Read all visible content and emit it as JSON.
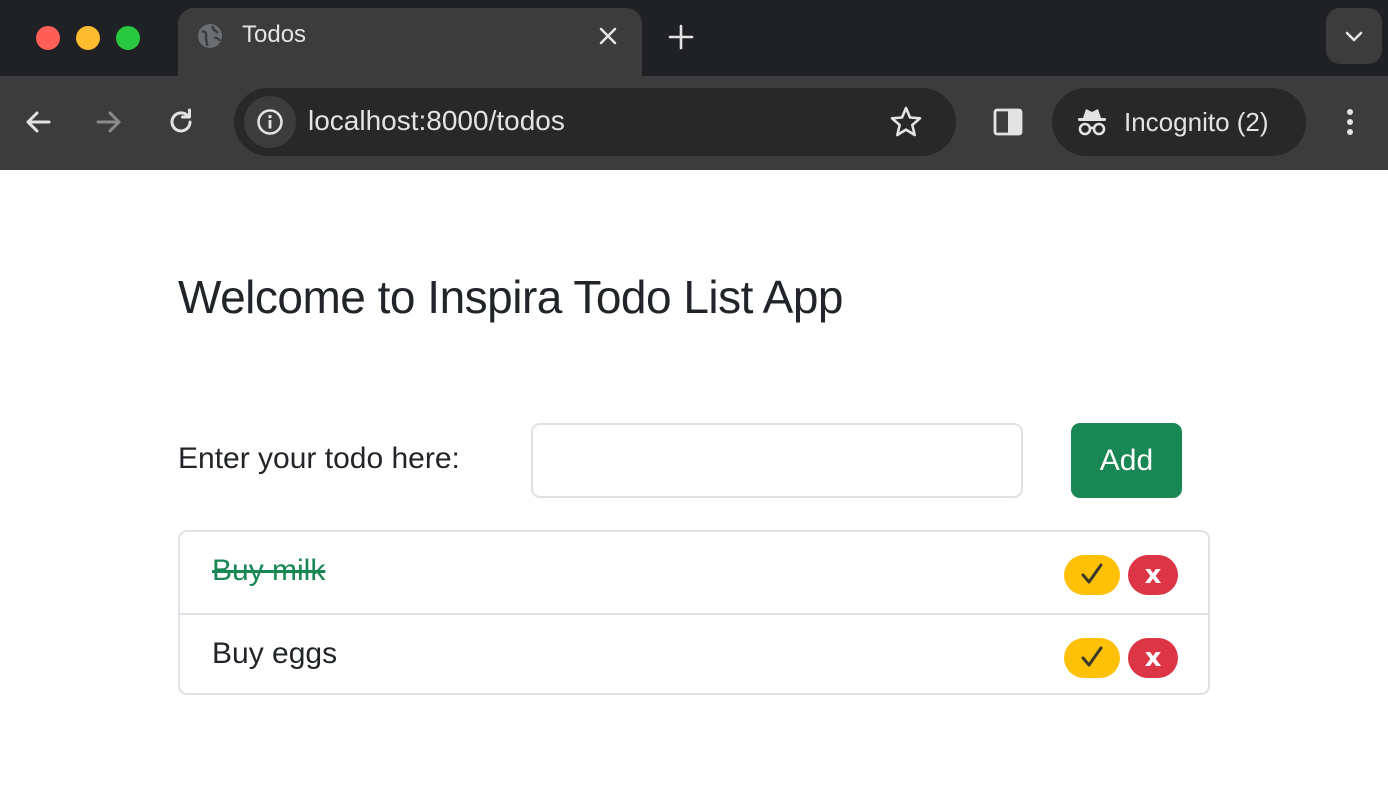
{
  "browser": {
    "tab": {
      "title": "Todos",
      "favicon": "globe-icon"
    },
    "url": "localhost:8000/todos",
    "incognito_label": "Incognito (2)",
    "colors": {
      "tabstrip": "#202124",
      "toolbar": "#3c3c3c",
      "omnibox": "#282828"
    }
  },
  "page": {
    "heading": "Welcome to Inspira Todo List App",
    "form": {
      "label": "Enter your todo here:",
      "input_value": "",
      "input_placeholder": "",
      "add_label": "Add"
    },
    "todos": [
      {
        "text": "Buy milk",
        "completed": true,
        "complete_icon": "checkmark-icon",
        "delete_label": "x"
      },
      {
        "text": "Buy eggs",
        "completed": false,
        "complete_icon": "checkmark-icon",
        "delete_label": "x"
      }
    ],
    "colors": {
      "add_button": "#198754",
      "complete_button": "#ffc107",
      "delete_button": "#dc3545",
      "completed_text": "#198754"
    }
  }
}
